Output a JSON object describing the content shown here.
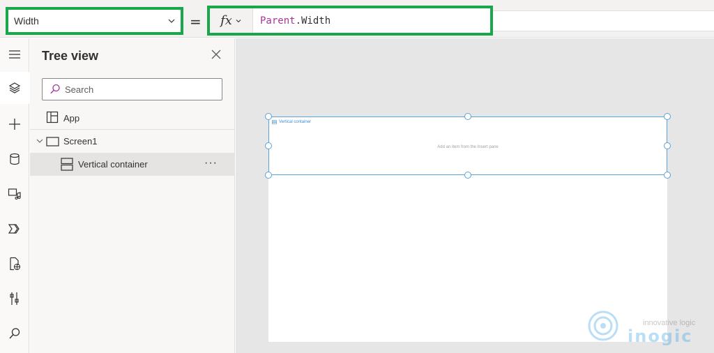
{
  "formula_bar": {
    "property": "Width",
    "equals": "=",
    "fx_label": "fx",
    "formula_keyword": "Parent",
    "formula_rest": ".Width"
  },
  "left_rail": {
    "items": [
      {
        "icon": "hamburger-icon"
      },
      {
        "icon": "layers-icon",
        "active": true
      },
      {
        "icon": "plus-icon"
      },
      {
        "icon": "database-icon"
      },
      {
        "icon": "media-icon"
      },
      {
        "icon": "power-automate-icon"
      },
      {
        "icon": "globe-document-icon"
      },
      {
        "icon": "tools-icon"
      },
      {
        "icon": "search-icon"
      }
    ]
  },
  "tree_view": {
    "title": "Tree view",
    "search_placeholder": "Search",
    "items": [
      {
        "label": "App",
        "icon": "app-icon"
      },
      {
        "label": "Screen1",
        "icon": "screen-icon",
        "expanded": true
      },
      {
        "label": "Vertical container",
        "icon": "vertical-container-icon",
        "selected": true,
        "more": "···"
      }
    ]
  },
  "canvas": {
    "container_label": "Vertical container",
    "container_hint": "Add an item from the Insert pane"
  },
  "watermark": {
    "tagline": "innovative logic",
    "brand": "inogic"
  },
  "colors": {
    "highlight_border": "#1aa64a",
    "formula_keyword": "#a4379a",
    "selection_blue": "#5aa2d6"
  }
}
